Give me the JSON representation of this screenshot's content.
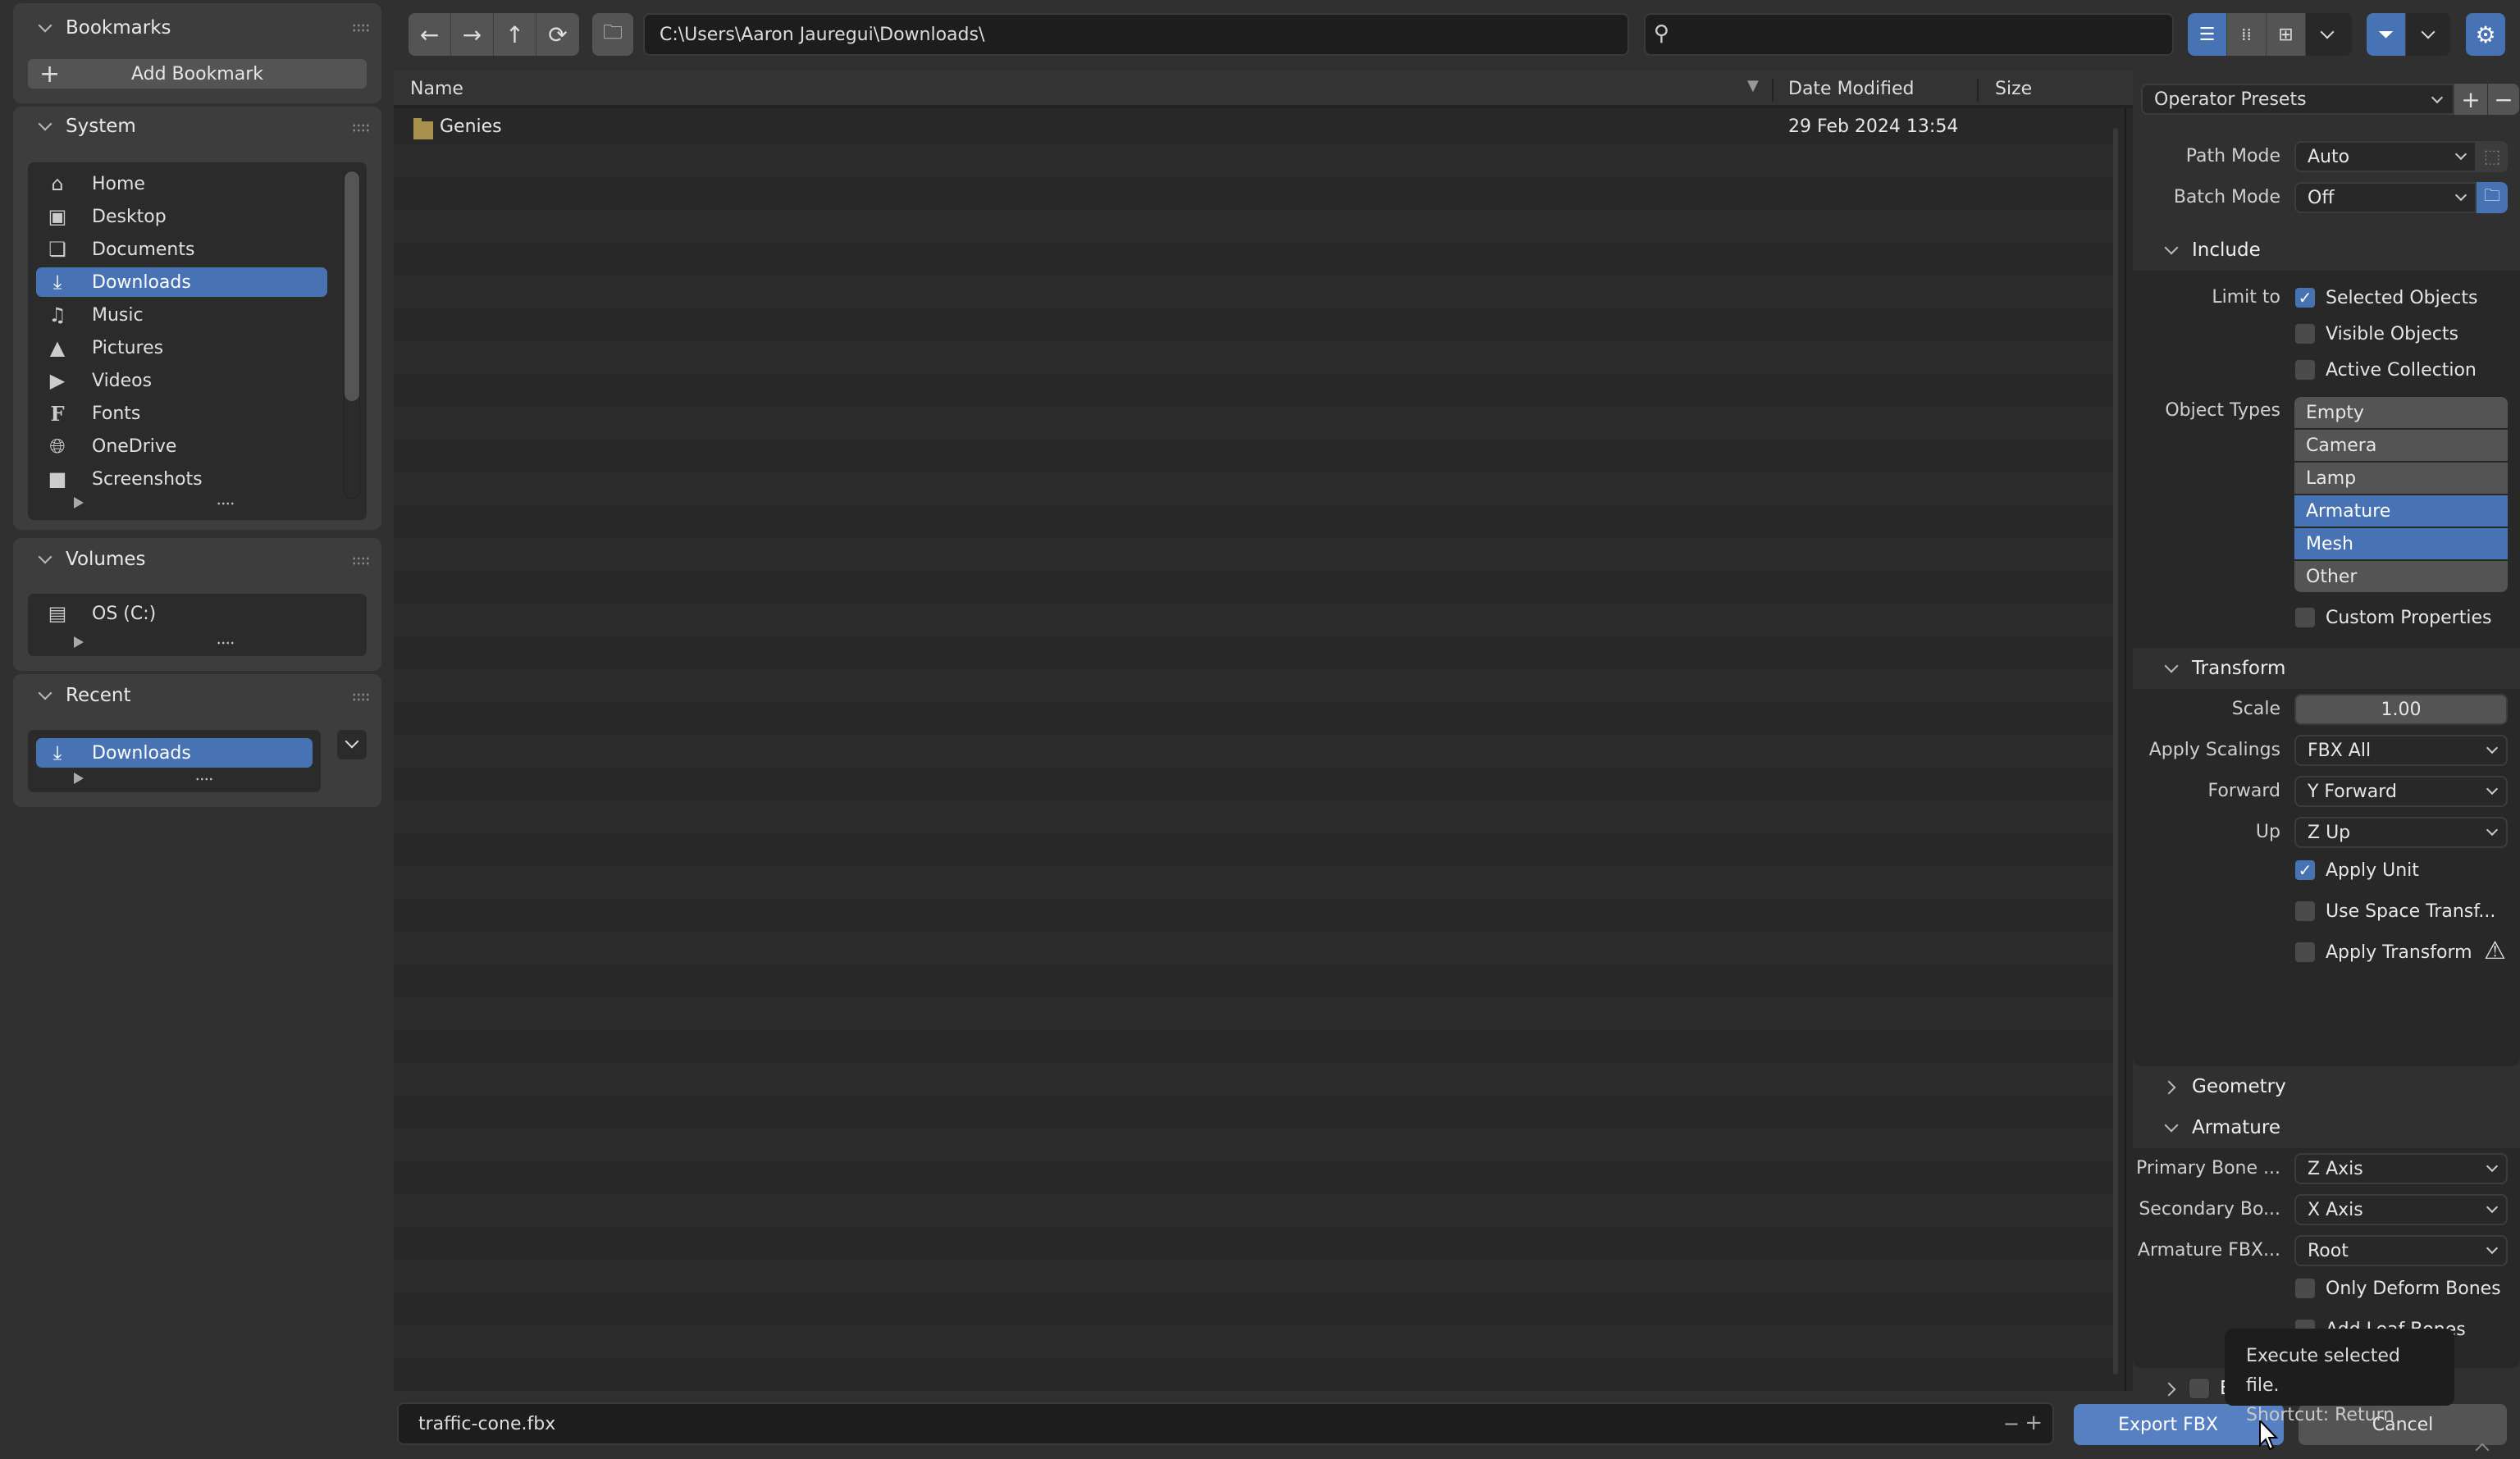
{
  "sidebar": {
    "bookmarks": {
      "title": "Bookmarks",
      "add_label": "Add Bookmark"
    },
    "system": {
      "title": "System",
      "items": [
        {
          "label": "Home",
          "icon": "home-icon"
        },
        {
          "label": "Desktop",
          "icon": "desktop-icon"
        },
        {
          "label": "Documents",
          "icon": "documents-icon"
        },
        {
          "label": "Downloads",
          "icon": "downloads-icon",
          "selected": true
        },
        {
          "label": "Music",
          "icon": "music-icon"
        },
        {
          "label": "Pictures",
          "icon": "pictures-icon"
        },
        {
          "label": "Videos",
          "icon": "videos-icon"
        },
        {
          "label": "Fonts",
          "icon": "fonts-icon"
        },
        {
          "label": "OneDrive",
          "icon": "onedrive-icon"
        },
        {
          "label": "Screenshots",
          "icon": "folder-icon"
        }
      ]
    },
    "volumes": {
      "title": "Volumes",
      "items": [
        {
          "label": "OS (C:)",
          "icon": "disk-icon"
        }
      ]
    },
    "recent": {
      "title": "Recent",
      "items": [
        {
          "label": "Downloads",
          "icon": "downloads-icon",
          "selected": true
        }
      ]
    }
  },
  "toolbar": {
    "path": "C:\\Users\\Aaron Jauregui\\Downloads\\",
    "search_value": "",
    "display_modes": [
      "vertical-list",
      "horizontal-list",
      "thumbnails"
    ],
    "active_display_mode": "vertical-list",
    "filter_enabled": true
  },
  "filelist": {
    "columns": {
      "name": "Name",
      "date": "Date Modified",
      "size": "Size"
    },
    "sort_indicator": "▼",
    "rows": [
      {
        "name": "Genies",
        "type": "folder",
        "date": "29 Feb 2024 13:54",
        "size": ""
      }
    ]
  },
  "props": {
    "presets_label": "Operator Presets",
    "path_mode": {
      "label": "Path Mode",
      "value": "Auto"
    },
    "batch_mode": {
      "label": "Batch Mode",
      "value": "Off"
    },
    "include": {
      "title": "Include",
      "limit_to_label": "Limit to",
      "selected_objects": {
        "label": "Selected Objects",
        "checked": true
      },
      "visible_objects": {
        "label": "Visible Objects",
        "checked": false
      },
      "active_collection": {
        "label": "Active Collection",
        "checked": false
      },
      "object_types_label": "Object Types",
      "object_types": [
        {
          "label": "Empty",
          "on": false
        },
        {
          "label": "Camera",
          "on": false
        },
        {
          "label": "Lamp",
          "on": false
        },
        {
          "label": "Armature",
          "on": true
        },
        {
          "label": "Mesh",
          "on": true
        },
        {
          "label": "Other",
          "on": false
        }
      ],
      "custom_properties": {
        "label": "Custom Properties",
        "checked": false
      }
    },
    "transform": {
      "title": "Transform",
      "scale": {
        "label": "Scale",
        "value": "1.00"
      },
      "apply_scalings": {
        "label": "Apply Scalings",
        "value": "FBX All"
      },
      "forward": {
        "label": "Forward",
        "value": "Y Forward"
      },
      "up": {
        "label": "Up",
        "value": "Z Up"
      },
      "apply_unit": {
        "label": "Apply Unit",
        "checked": true
      },
      "use_space_transform": {
        "label": "Use Space Transf...",
        "checked": false
      },
      "apply_transform": {
        "label": "Apply Transform",
        "checked": false
      }
    },
    "geometry": {
      "title": "Geometry"
    },
    "armature": {
      "title": "Armature",
      "primary_bone": {
        "label": "Primary Bone ...",
        "value": "Z Axis"
      },
      "secondary_bone": {
        "label": "Secondary Bo...",
        "value": "X Axis"
      },
      "armature_fbx": {
        "label": "Armature FBX...",
        "value": "Root"
      },
      "only_deform": {
        "label": "Only Deform Bones",
        "checked": false
      },
      "add_leaf": {
        "label": "Add Leaf Bones",
        "checked": false
      }
    },
    "bake_animation": {
      "label": "Bake Animation",
      "checked": false
    }
  },
  "footer": {
    "filename": "traffic-cone.fbx",
    "export_label": "Export FBX",
    "cancel_label": "Cancel"
  },
  "tooltip": {
    "line1": "Execute selected file.",
    "line2": "Shortcut: Return"
  },
  "colors": {
    "accent": "#4772b3",
    "folder": "#a8904f"
  }
}
